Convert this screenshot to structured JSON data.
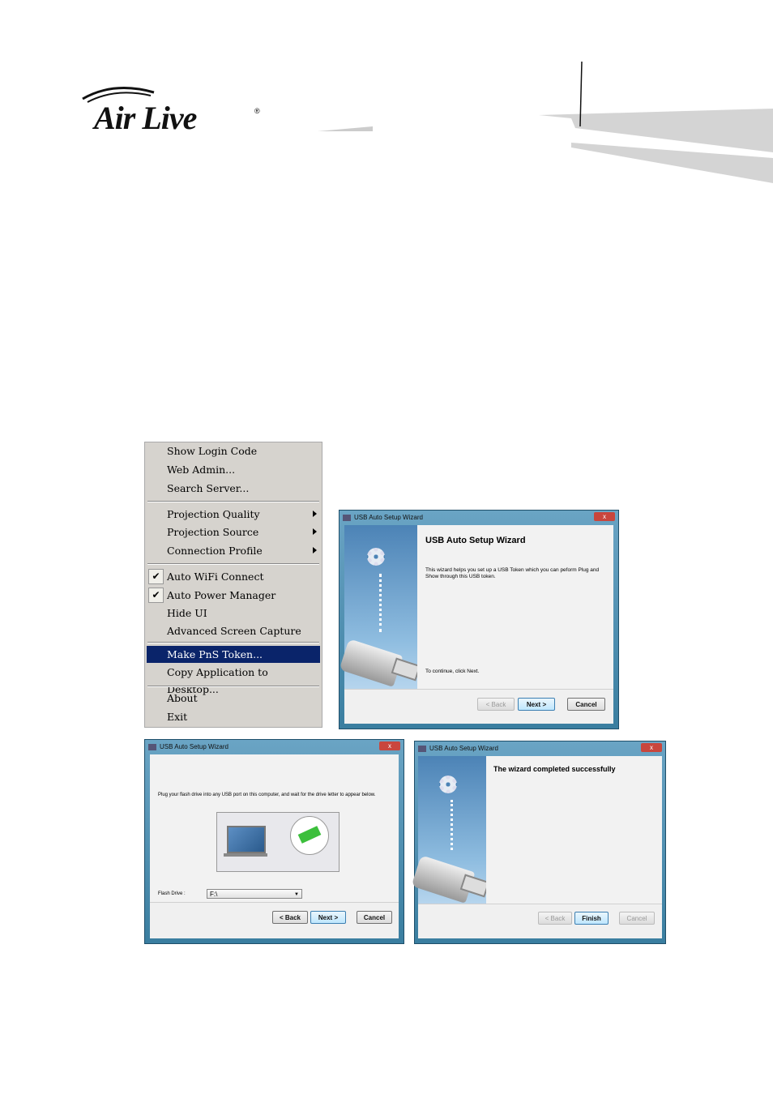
{
  "logo": {
    "text": "Air Live",
    "registered": "®"
  },
  "menu": {
    "items": [
      {
        "label": "Show Login Code"
      },
      {
        "label": "Web Admin..."
      },
      {
        "label": "Search Server..."
      },
      {
        "label": "Projection Quality",
        "submenu": true
      },
      {
        "label": "Projection Source",
        "submenu": true
      },
      {
        "label": "Connection Profile",
        "submenu": true
      },
      {
        "label": "Auto WiFi Connect",
        "checked": true
      },
      {
        "label": "Auto Power Manager",
        "checked": true
      },
      {
        "label": "Hide UI"
      },
      {
        "label": "Advanced Screen Capture"
      },
      {
        "label": "Make PnS Token...",
        "selected": true
      },
      {
        "label": "Copy Application to Desktop..."
      },
      {
        "label": "About"
      },
      {
        "label": "Exit"
      }
    ],
    "check_glyph": "✔"
  },
  "wizard1": {
    "title": "USB Auto Setup Wizard",
    "heading": "USB Auto Setup Wizard",
    "description": "This wizard helps you set up a USB Token which you can peform Plug and Show through this USB token.",
    "continue_text": "To continue, click Next.",
    "back": "< Back",
    "next": "Next >",
    "cancel": "Cancel",
    "close": "x"
  },
  "wizard2": {
    "title": "USB Auto Setup Wizard",
    "instruction": "Plug your flash drive into any USB port on this computer, and wait for the drive letter to appear below.",
    "flash_drive_label": "Flash Drive :",
    "flash_drive_value": "F:\\",
    "back": "< Back",
    "next": "Next >",
    "cancel": "Cancel",
    "close": "x"
  },
  "wizard3": {
    "title": "USB Auto Setup Wizard",
    "heading": "The wizard completed successfully",
    "back": "< Back",
    "finish": "Finish",
    "cancel": "Cancel",
    "close": "x"
  },
  "colors": {
    "menu_highlight": "#0a246a",
    "menu_bg": "#d6d3ce",
    "window_frame": "#3a7ea0"
  }
}
